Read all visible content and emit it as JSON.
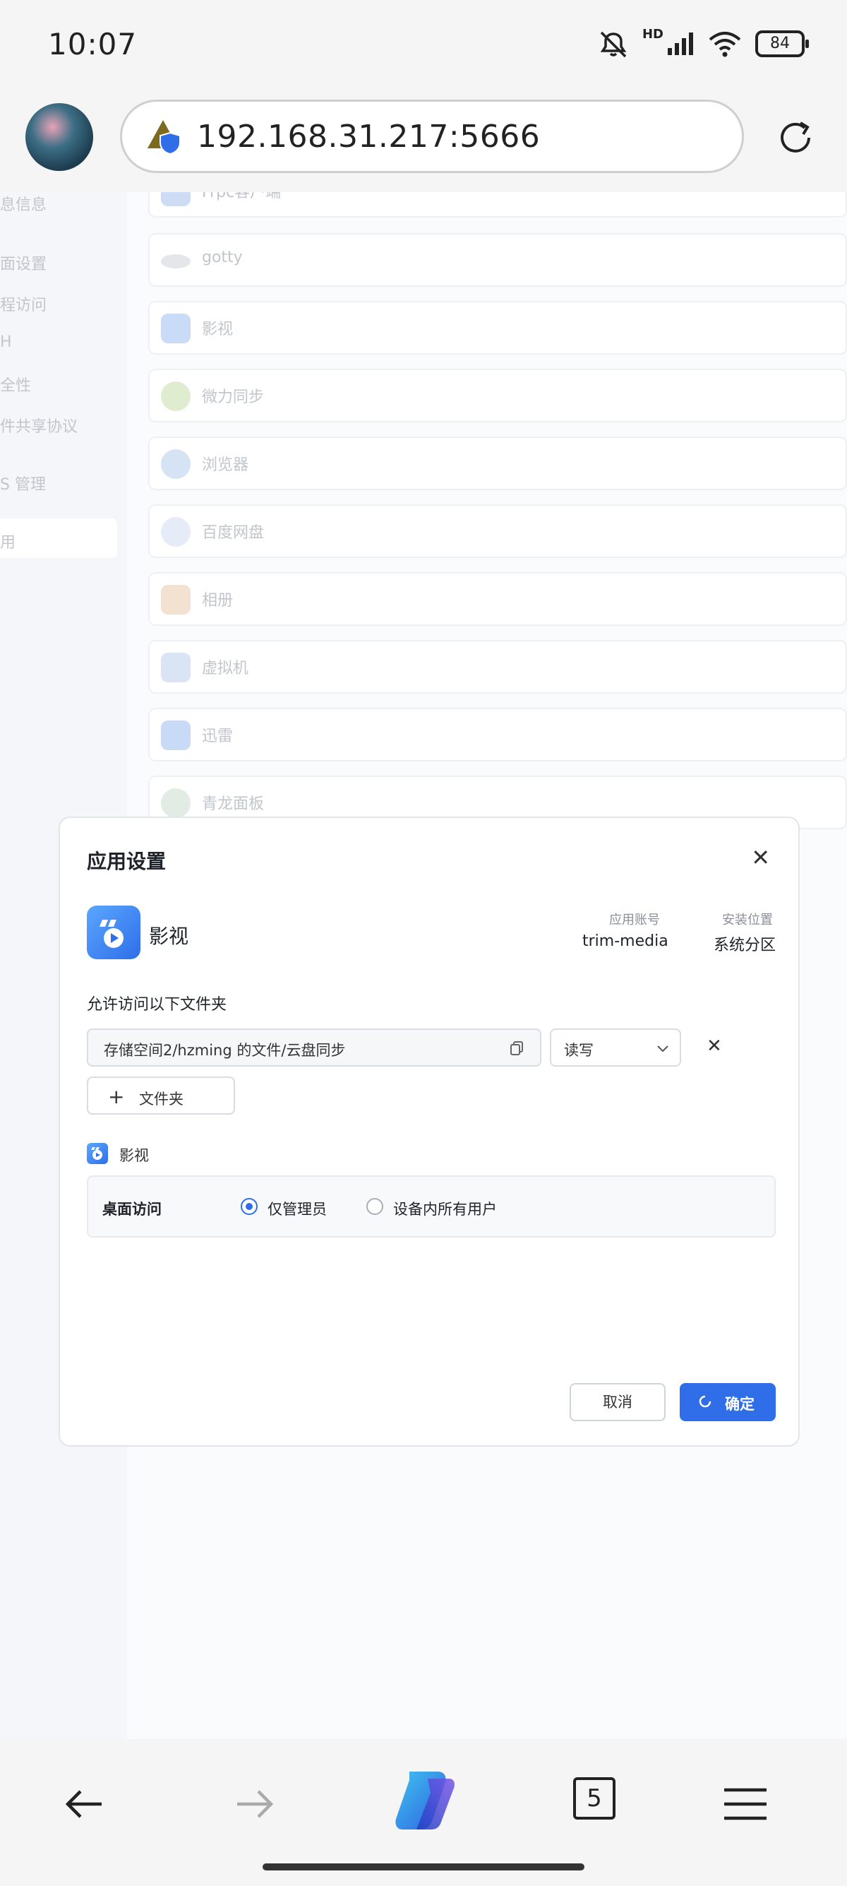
{
  "status_bar": {
    "time": "10:07",
    "battery": "84",
    "signal_tag": "HD"
  },
  "browser": {
    "url": "192.168.31.217:5666",
    "tab_count": "5"
  },
  "sidebar": {
    "items": [
      "息信息",
      "面设置",
      "程访问",
      "H",
      "全性",
      "件共享协议",
      "S 管理",
      "用"
    ]
  },
  "app_list": [
    {
      "name": "Frpc客户端",
      "icon": "frpc-icon"
    },
    {
      "name": "gotty",
      "icon": "gotty-icon"
    },
    {
      "name": "影视",
      "icon": "film-icon"
    },
    {
      "name": "微力同步",
      "icon": "sync-icon"
    },
    {
      "name": "浏览器",
      "icon": "browser-icon"
    },
    {
      "name": "百度网盘",
      "icon": "cloud-icon"
    },
    {
      "name": "相册",
      "icon": "photo-icon"
    },
    {
      "name": "虚拟机",
      "icon": "vm-icon"
    },
    {
      "name": "迅雷",
      "icon": "thunder-icon"
    },
    {
      "name": "青龙面板",
      "icon": "qinglong-icon"
    }
  ],
  "modal": {
    "title": "应用设置",
    "app_name": "影视",
    "account_label": "应用账号",
    "account_value": "trim-media",
    "location_label": "安装位置",
    "location_value": "系统分区",
    "folders_label": "允许访问以下文件夹",
    "folder_path": "存储空间2/hzming 的文件/云盘同步",
    "permission": "读写",
    "add_folder_label": "文件夹",
    "sub_app_name": "影视",
    "desktop_access_label": "桌面访问",
    "option_admin": "仅管理员",
    "option_all_users": "设备内所有用户",
    "selected_option": "仅管理员",
    "cancel_label": "取消",
    "confirm_label": "确定"
  },
  "colors": {
    "accent": "#2f6ee8",
    "bg": "#f5f5f5"
  }
}
